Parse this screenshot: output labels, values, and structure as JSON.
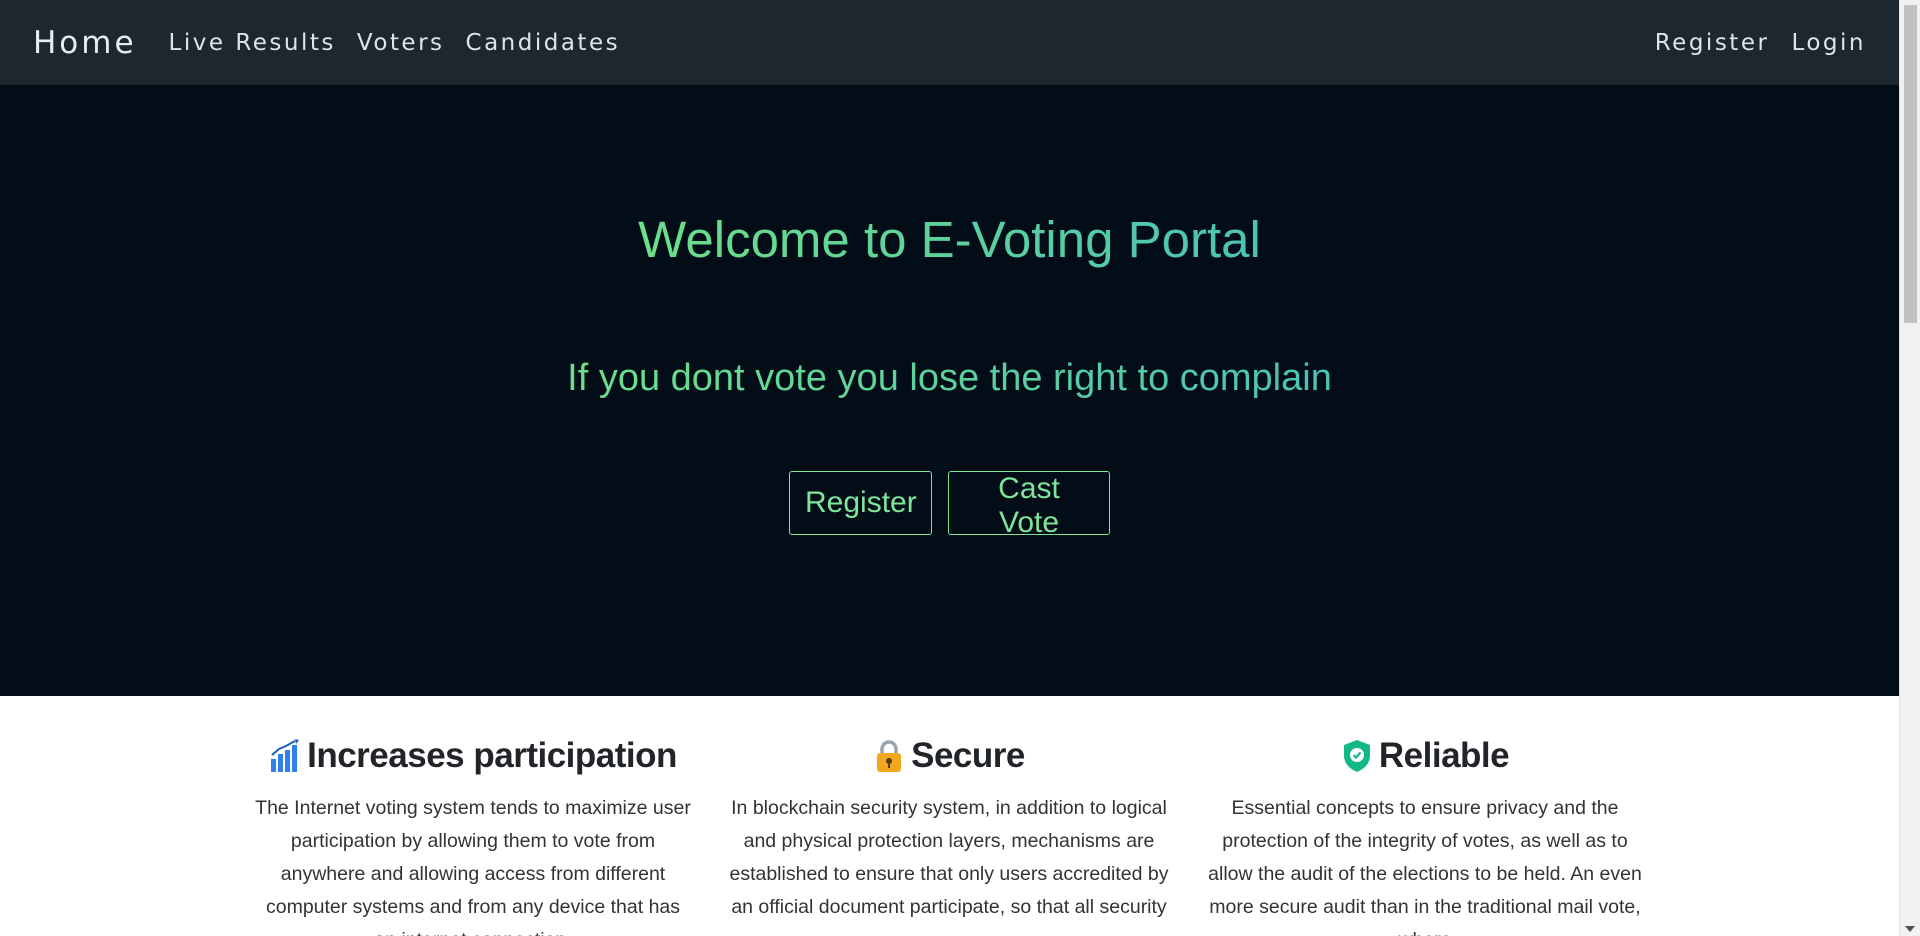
{
  "navbar": {
    "brand": "Home",
    "links": [
      "Live Results",
      "Voters",
      "Candidates"
    ],
    "right_links": [
      "Register",
      "Login"
    ]
  },
  "hero": {
    "title": "Welcome to E-Voting Portal",
    "tagline": "If you dont vote you lose the right to complain",
    "buttons": [
      "Register",
      "Cast Vote"
    ],
    "accent_colors": [
      "#6ce089",
      "#4cc2b4"
    ]
  },
  "features": [
    {
      "icon": "bar-chart-icon",
      "title": "Increases participation",
      "text": "The Internet voting system tends to maximize user participation by allowing them to vote from anywhere and allowing access from different computer systems and from any device that has an internet connection."
    },
    {
      "icon": "lock-icon",
      "title": "Secure",
      "text": "In blockchain security system, in addition to logical and physical protection layers, mechanisms are established to ensure that only users accredited by an official document participate, so that all security"
    },
    {
      "icon": "shield-check-icon",
      "title": "Reliable",
      "text": "Essential concepts to ensure privacy and the protection of the integrity of votes, as well as to allow the audit of the elections to be held. An even more secure audit than in the traditional mail vote, where"
    }
  ]
}
